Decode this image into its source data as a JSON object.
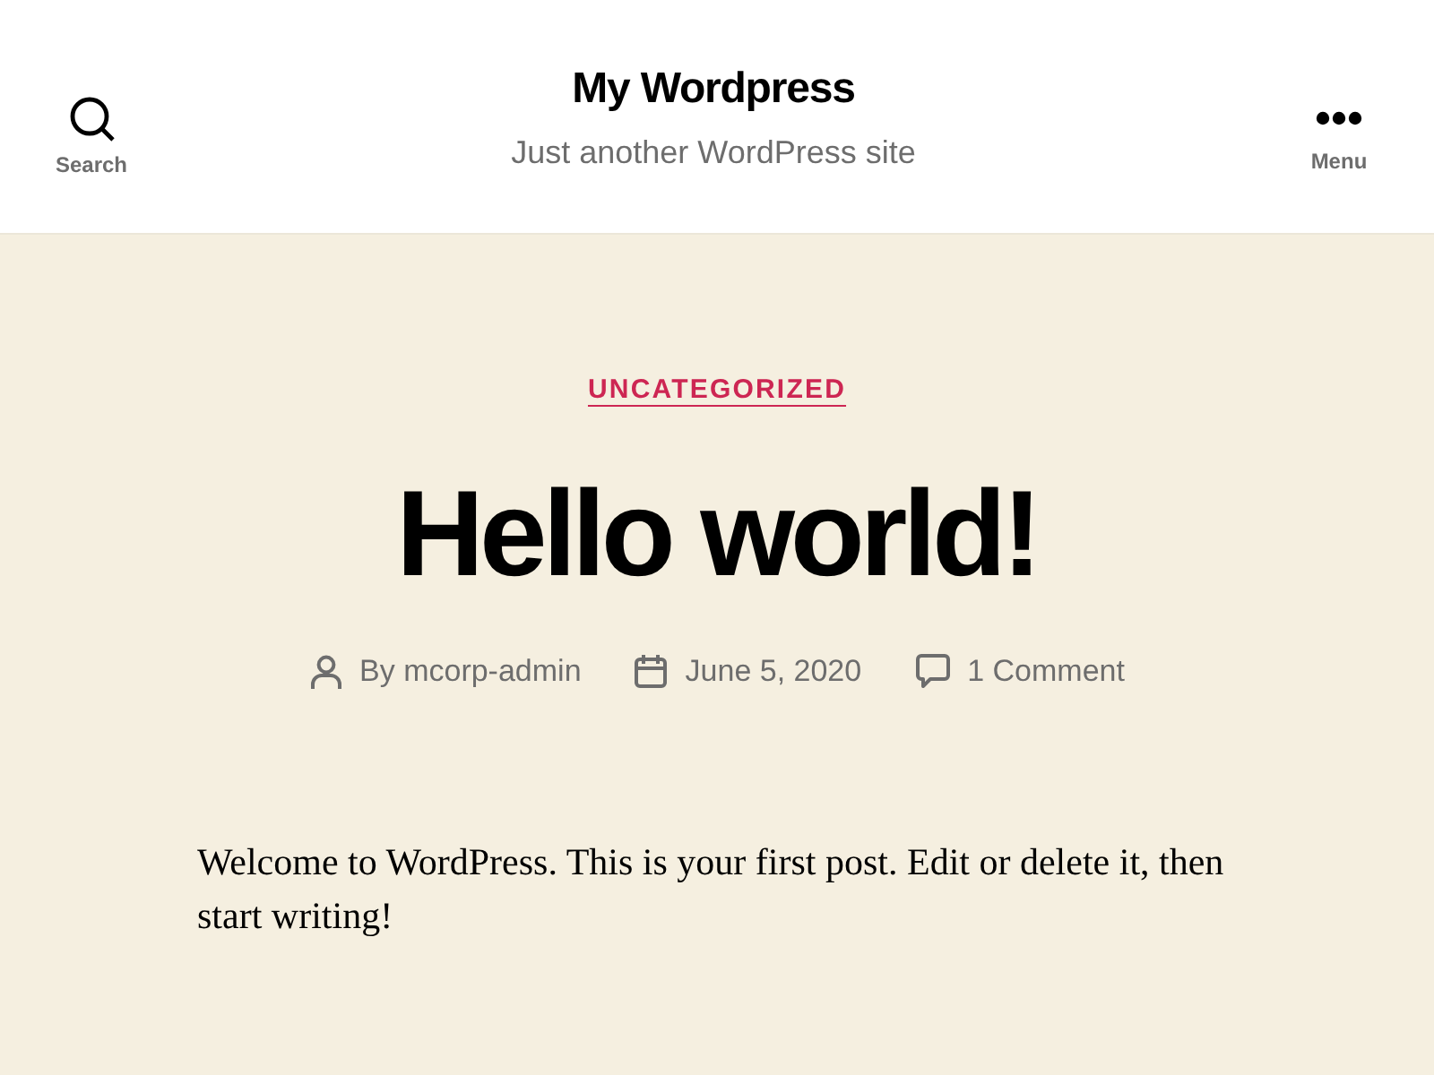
{
  "header": {
    "site_title": "My Wordpress",
    "tagline": "Just another WordPress site",
    "search_button": {
      "label": "Search"
    },
    "menu_button": {
      "label": "Menu"
    }
  },
  "post": {
    "category": "UNCATEGORIZED",
    "title": "Hello world!",
    "meta": [
      {
        "kind": "author",
        "text": "By mcorp-admin"
      },
      {
        "kind": "date",
        "text": "June 5, 2020"
      },
      {
        "kind": "comments",
        "text": "1 Comment"
      }
    ],
    "body": "Welcome to WordPress. This is your first post. Edit or delete it, then start writing!"
  }
}
